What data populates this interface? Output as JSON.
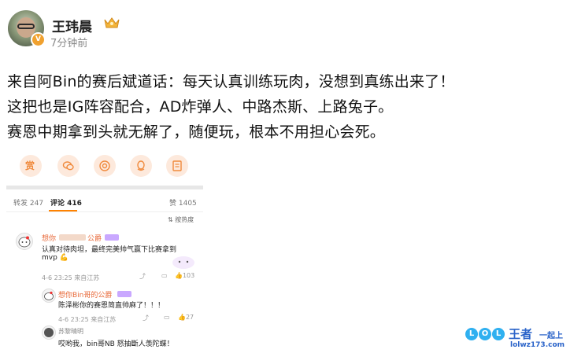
{
  "post": {
    "author": "王玮晨",
    "time": "7分钟前",
    "lines": [
      "来自阿Bin的赛后斌道话：每天认真训练玩肉，没想到真练出来了！",
      "这把也是IG阵容配合，AD炸弹人、中路杰斯、上路兔子。",
      "赛恩中期拿到头就无解了，随便玩，根本不用担心会死。"
    ]
  },
  "share_icons": [
    "reward-icon",
    "wechat-icon",
    "moments-icon",
    "qq-icon",
    "qzone-icon"
  ],
  "share_icon_color": "#f08a3c",
  "share_reward_label": "赏",
  "embedded": {
    "repost_label": "转发 247",
    "comment_label": "评论 416",
    "like_label": "赞 1405",
    "sort_label": "按热度",
    "comments": [
      {
        "user": "想你",
        "user_tail": "公爵",
        "text_line1": "认真对待肉坦，最终完美帅气赢下比赛拿到",
        "text_line2": "mvp",
        "meta": "4-6 23:25 来自江苏",
        "likes": "103"
      },
      {
        "user": "想你Bin哥的公爵",
        "text": "陈泽彬你的赛恩简直帅麻了！！！",
        "meta": "4-6 23:25 来自江苏",
        "likes": "27"
      },
      {
        "user": "苏黎晴明",
        "text": "哎哟我，bin哥NB 怒抽斷人羡陀蝶！"
      }
    ]
  },
  "watermark": {
    "lol": [
      "L",
      "O",
      "L"
    ],
    "zhe": "王者",
    "yiqi": "一起上",
    "site": "lolwz173.com"
  }
}
